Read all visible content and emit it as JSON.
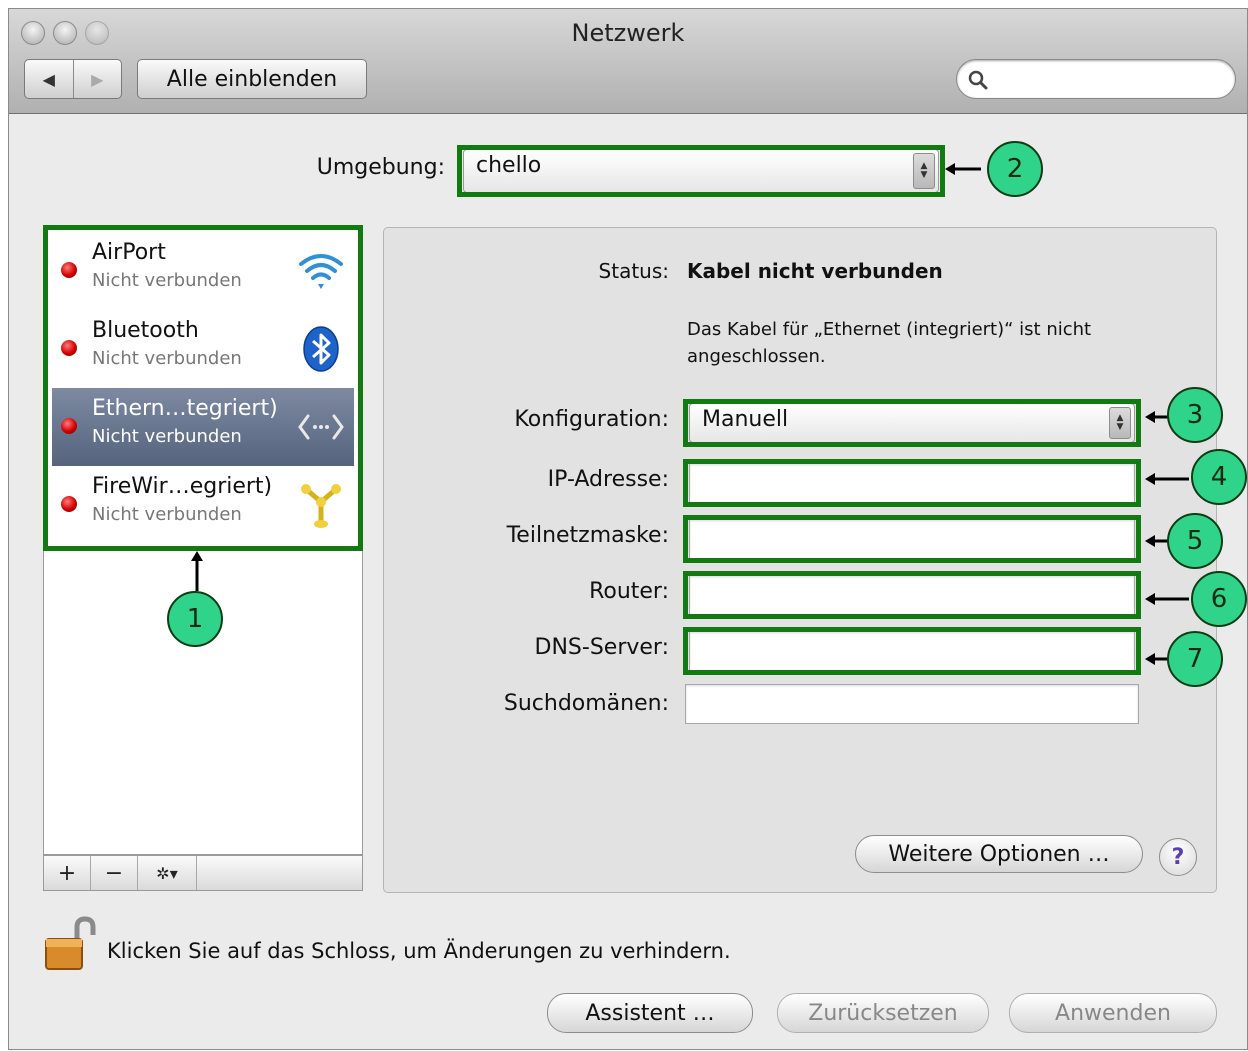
{
  "window": {
    "title": "Netzwerk"
  },
  "toolbar": {
    "back": "◀",
    "forward": "▶",
    "show_all_label": "Alle einblenden",
    "search_placeholder": ""
  },
  "location": {
    "label": "Umgebung:",
    "value": "chello"
  },
  "services": [
    {
      "name": "AirPort",
      "status": "Nicht verbunden",
      "icon": "wifi-icon",
      "selected": false
    },
    {
      "name": "Bluetooth",
      "status": "Nicht verbunden",
      "icon": "bluetooth-icon",
      "selected": false
    },
    {
      "name": "Ethern…tegriert)",
      "status": "Nicht verbunden",
      "icon": "ethernet-icon",
      "selected": true
    },
    {
      "name": "FireWir…egriert)",
      "status": "Nicht verbunden",
      "icon": "firewire-icon",
      "selected": false
    }
  ],
  "list_buttons": {
    "add": "+",
    "remove": "−",
    "gear": "✲▾"
  },
  "detail": {
    "status_label": "Status:",
    "status_value": "Kabel nicht verbunden",
    "status_desc_line1": "Das Kabel für „Ethernet (integriert)“ ist nicht",
    "status_desc_line2": "angeschlossen.",
    "config_label": "Konfiguration:",
    "config_value": "Manuell",
    "ip_label": "IP-Adresse:",
    "ip_value": "",
    "subnet_label": "Teilnetzmaske:",
    "subnet_value": "",
    "router_label": "Router:",
    "router_value": "",
    "dns_label": "DNS-Server:",
    "dns_value": "",
    "search_domains_label": "Suchdomänen:",
    "search_domains_value": "",
    "more_options_label": "Weitere Optionen …",
    "help_label": "?"
  },
  "lock": {
    "text": "Klicken Sie auf das Schloss, um Änderungen zu verhindern."
  },
  "footer": {
    "assistant_label": "Assistent …",
    "revert_label": "Zurücksetzen",
    "apply_label": "Anwenden"
  },
  "callouts": [
    "1",
    "2",
    "3",
    "4",
    "5",
    "6",
    "7"
  ],
  "colors": {
    "highlight": "#117a11",
    "callout_fill": "#2fd48a",
    "status_red": "#d10000",
    "selection": "#5d6a84"
  }
}
